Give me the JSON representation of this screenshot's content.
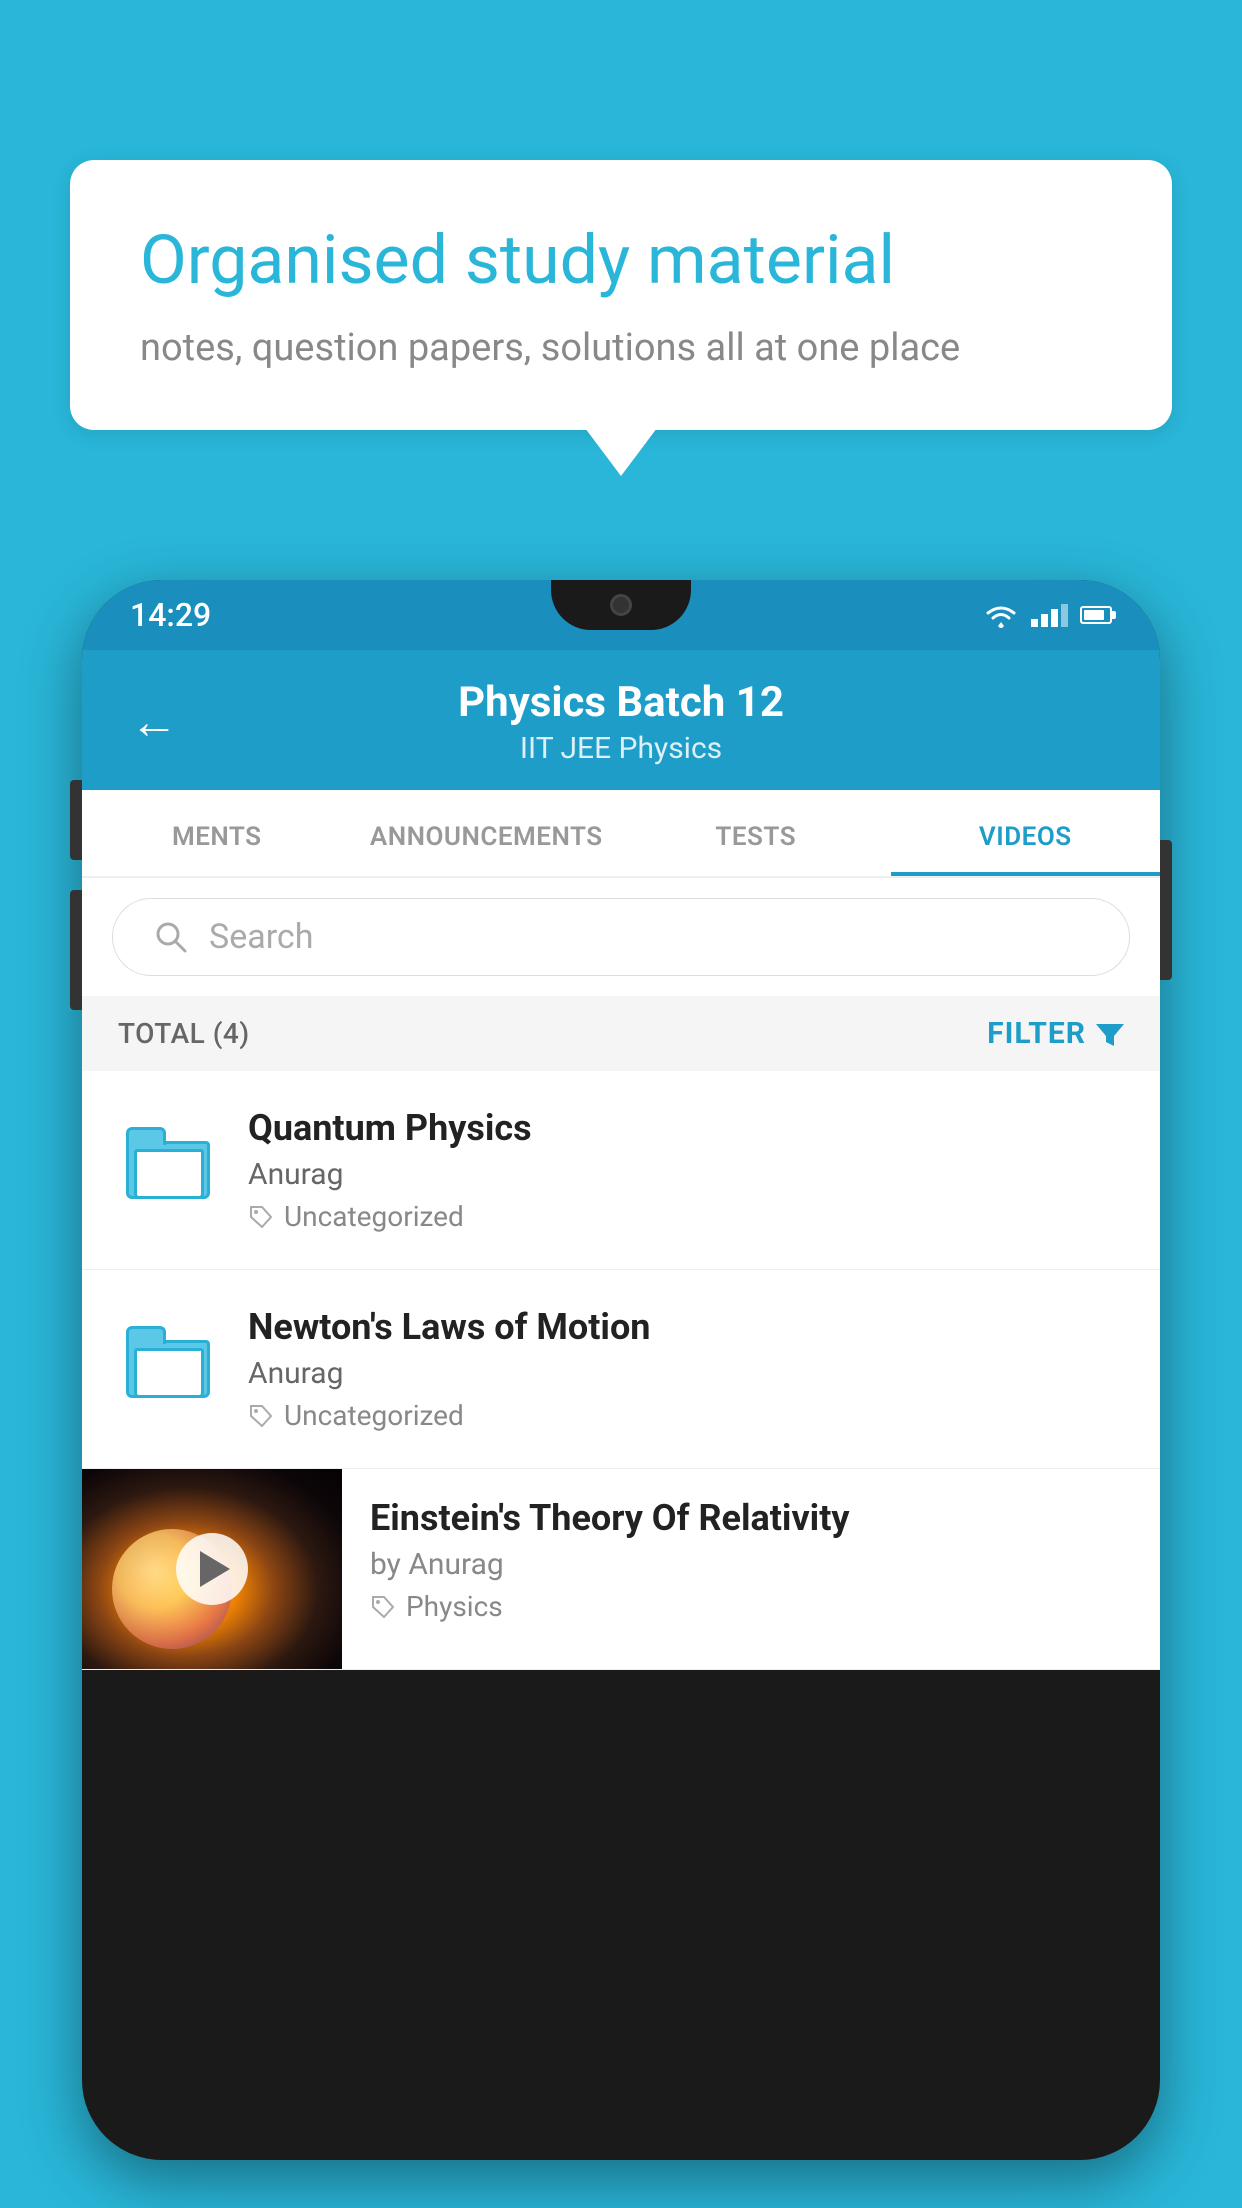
{
  "background_color": "#29b6d8",
  "speech_bubble": {
    "title": "Organised study material",
    "subtitle": "notes, question papers, solutions all at one place"
  },
  "status_bar": {
    "time": "14:29",
    "color": "#1a8fbe"
  },
  "app_header": {
    "title": "Physics Batch 12",
    "subtitle_parts": [
      "IIT JEE",
      "Physics"
    ],
    "subtitle": "IIT JEE   Physics",
    "back_label": "←"
  },
  "tabs": [
    {
      "label": "MENTS",
      "active": false
    },
    {
      "label": "ANNOUNCEMENTS",
      "active": false
    },
    {
      "label": "TESTS",
      "active": false
    },
    {
      "label": "VIDEOS",
      "active": true
    }
  ],
  "search": {
    "placeholder": "Search"
  },
  "filter_bar": {
    "total_label": "TOTAL (4)",
    "filter_label": "FILTER"
  },
  "videos": [
    {
      "title": "Quantum Physics",
      "author": "Anurag",
      "tag": "Uncategorized",
      "has_thumbnail": false
    },
    {
      "title": "Newton's Laws of Motion",
      "author": "Anurag",
      "tag": "Uncategorized",
      "has_thumbnail": false
    },
    {
      "title": "Einstein's Theory Of Relativity",
      "author": "by Anurag",
      "tag": "Physics",
      "has_thumbnail": true
    }
  ]
}
